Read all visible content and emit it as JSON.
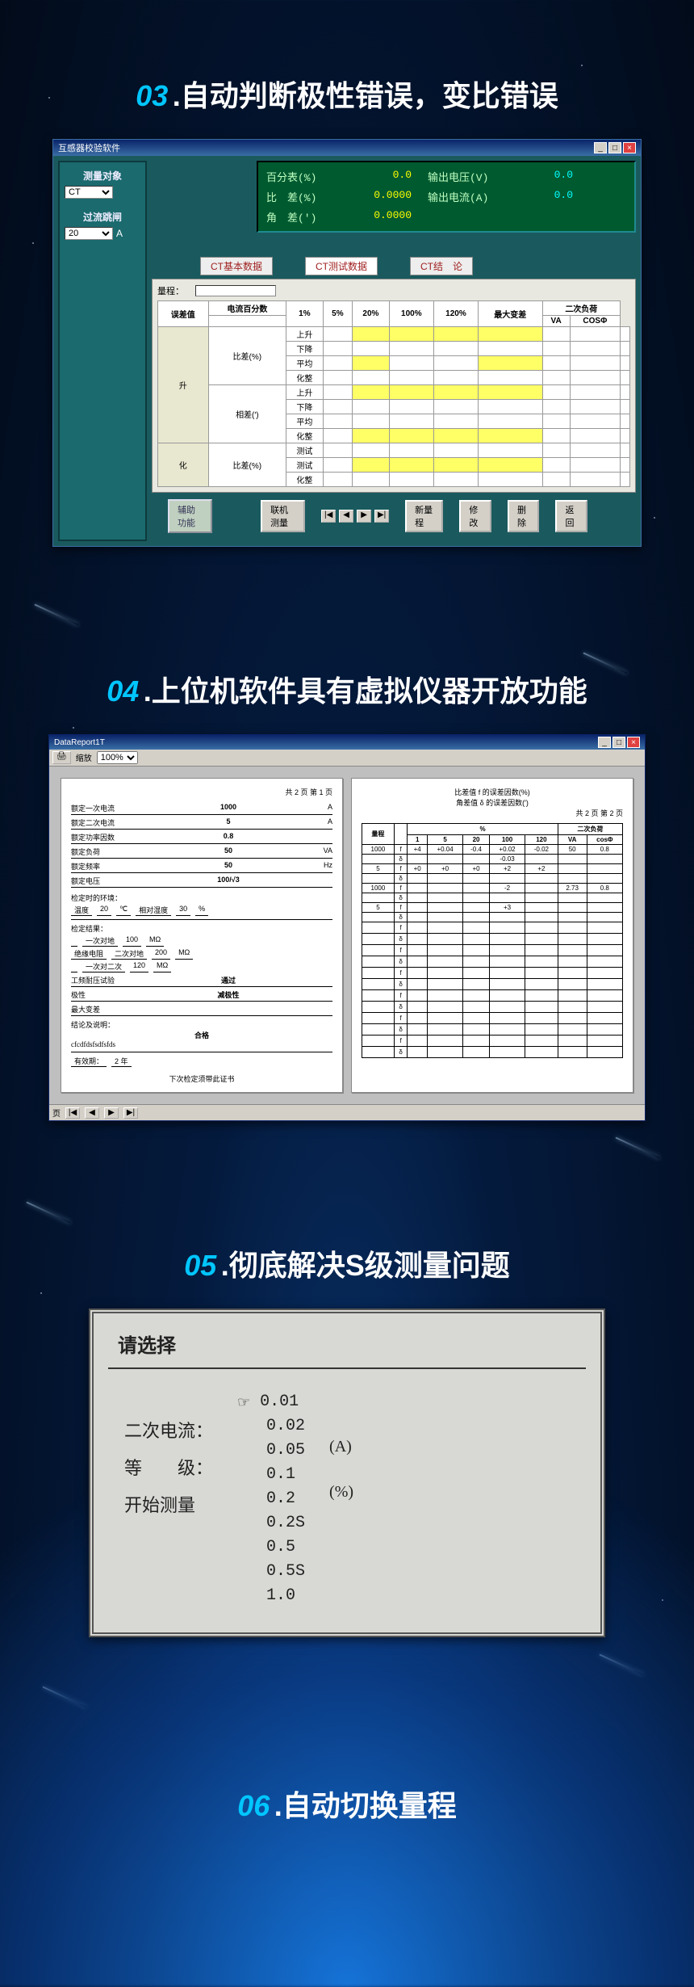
{
  "sections": {
    "s03": {
      "num": "03",
      "title": "自动判断极性错误，变比错误"
    },
    "s04": {
      "num": "04",
      "title": "上位机软件具有虚拟仪器开放功能"
    },
    "s05": {
      "num": "05",
      "title": "彻底解决S级测量问题"
    },
    "s06": {
      "num": "06",
      "title": "自动切换量程"
    }
  },
  "win1": {
    "title": "互感器校验软件",
    "left": {
      "measure_obj_label": "测量对象",
      "measure_obj_value": "CT",
      "jump_label": "过流跳闸",
      "jump_value": "20",
      "jump_unit": "A"
    },
    "status": {
      "pct_label": "百分表(%)",
      "pct_val": "0.0",
      "vout_label": "输出电压(V)",
      "vout_val": "0.0",
      "ratio_label": "比　差(%)",
      "ratio_val": "0.0000",
      "iout_label": "输出电流(A)",
      "iout_val": "0.0",
      "ang_label": "角　差(′)",
      "ang_val": "0.0000"
    },
    "tabs": {
      "t1": "CT基本数据",
      "t2": "CT测试数据",
      "t3": "CT结　论"
    },
    "range_label": "量程：",
    "tbl": {
      "h_err": "误差值",
      "h_pct": "电流百分数",
      "cols": [
        "1%",
        "5%",
        "20%",
        "100%",
        "120%",
        "最大变差",
        "二次负荷"
      ],
      "sub_va": "VA",
      "sub_cos": "COSΦ",
      "r1": "比差(%)",
      "r2": "相差(′)",
      "r3": "比差(%)",
      "r4": "相差(′)",
      "g1": "升",
      "g2": "化",
      "sub": [
        "上升",
        "下降",
        "平均",
        "化整"
      ],
      "sub2": [
        "测试",
        "测试",
        "化整"
      ]
    },
    "aux_btn": "辅助功能",
    "btns": {
      "link": "联机测量",
      "newrange": "新量程",
      "mod": "修改",
      "del": "删除",
      "ret": "返回"
    }
  },
  "win2": {
    "title": "DataReport1T",
    "zoom": "缩放",
    "page1": {
      "pg": "共 2 页 第 1 页",
      "rows": [
        {
          "l": "额定一次电流",
          "v": "1000",
          "u": "A"
        },
        {
          "l": "额定二次电流",
          "v": "5",
          "u": "A"
        },
        {
          "l": "额定功率因数",
          "v": "0.8",
          "u": ""
        },
        {
          "l": "额定负荷",
          "v": "50",
          "u": "VA"
        },
        {
          "l": "额定频率",
          "v": "50",
          "u": "Hz"
        },
        {
          "l": "额定电压",
          "v": "100/√3",
          "u": ""
        }
      ],
      "env_label": "检定时的环境：",
      "temp_label": "温度",
      "temp_v": "20",
      "temp_u": "℃",
      "hum_label": "相对湿度",
      "hum_v": "30",
      "hum_u": "%",
      "result_label": "检定结果：",
      "r_complex": "一次对地",
      "r_cv": "100",
      "r_cu": "MΩ",
      "r_ins": "绝缘电阻",
      "r_ins2": "二次对地",
      "r_iv": "200",
      "r_iu": "MΩ",
      "r_ins3": "一次对二次",
      "r_3v": "120",
      "r_3u": "MΩ",
      "r_wf": "工频耐压试验",
      "r_wf_v": "通过",
      "r_pol": "极性",
      "r_pol_v": "减极性",
      "r_max": "最大变差",
      "conc_label": "结论及说明：",
      "conc_v": "合格",
      "stamp": "cfcdfdsfsdfsfds",
      "valid": "有效期：",
      "valid_v": "2 年",
      "foot": "下次检定须带此证书"
    },
    "page2": {
      "pg": "共 2 页 第 2 页",
      "t1": "比差值 f 的误差因数(%)",
      "t2": "角差值 δ 的误差因数(′)",
      "h_range": "量程",
      "h_load": "二次负荷",
      "cols": [
        "1",
        "5",
        "20",
        "100",
        "120",
        "VA",
        "cosΦ"
      ],
      "rows": [
        {
          "r": "1000",
          "f": [
            "+4",
            "+0.04",
            "-0.4",
            "+0.02",
            "-0.02"
          ],
          "va": "50",
          "cos": "0.8",
          "h": "-0.03"
        },
        {
          "r": "5",
          "f": [
            "+0",
            "+0",
            "+0",
            "+2",
            "+2"
          ],
          "va": "",
          "cos": "",
          "h": ""
        },
        {
          "r": "1000",
          "f": [
            "",
            "",
            "",
            "-2",
            ""
          ],
          "va": "2.73",
          "cos": "0.8",
          "h": ""
        },
        {
          "r": "5",
          "f": [
            "",
            "",
            "",
            "+3",
            ""
          ],
          "va": "",
          "cos": "",
          "h": ""
        }
      ],
      "groups": [
        "f",
        "δ",
        "f",
        "δ",
        "f",
        "δ",
        "f",
        "δ",
        "f",
        "δ",
        "f",
        "δ",
        "f",
        "δ",
        "f",
        "δ"
      ]
    },
    "status_pages": "页"
  },
  "win3": {
    "title": "请选择",
    "labels": {
      "l1": "二次电流：",
      "l2": "等　　级：",
      "l3": "开始测量"
    },
    "cursor": "☞",
    "vals": [
      "0.01",
      "0.02",
      "0.05",
      "0.1",
      "0.2",
      "0.2S",
      "0.5",
      "0.5S",
      "1.0"
    ],
    "units": {
      "u1": "(A)",
      "u2": "(%)"
    }
  }
}
